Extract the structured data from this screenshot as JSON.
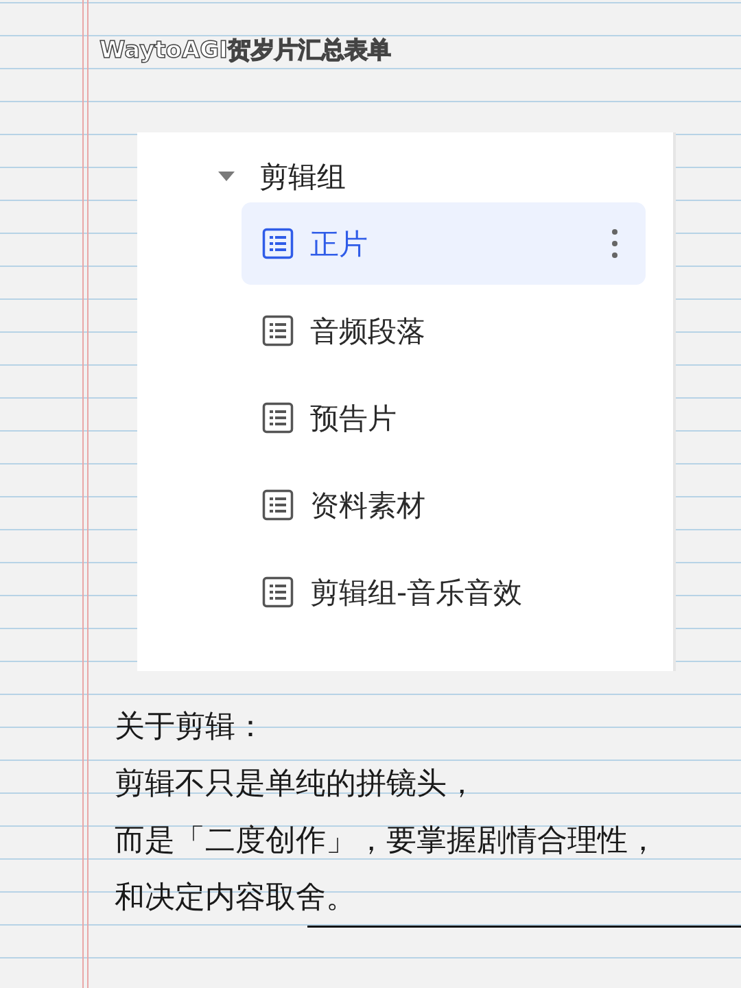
{
  "title": "WaytoAGI贺岁片汇总表单",
  "tree": {
    "label": "剪辑组",
    "expanded": true,
    "children": [
      {
        "label": "正片",
        "selected": true
      },
      {
        "label": "音频段落",
        "selected": false
      },
      {
        "label": "预告片",
        "selected": false
      },
      {
        "label": "资料素材",
        "selected": false
      },
      {
        "label": "剪辑组-音乐音效",
        "selected": false
      }
    ]
  },
  "paragraph": [
    "关于剪辑：",
    "剪辑不只是单纯的拼镜头，",
    "而是「二度创作」，要掌握剧情合理性，",
    "和决定内容取舍。"
  ]
}
